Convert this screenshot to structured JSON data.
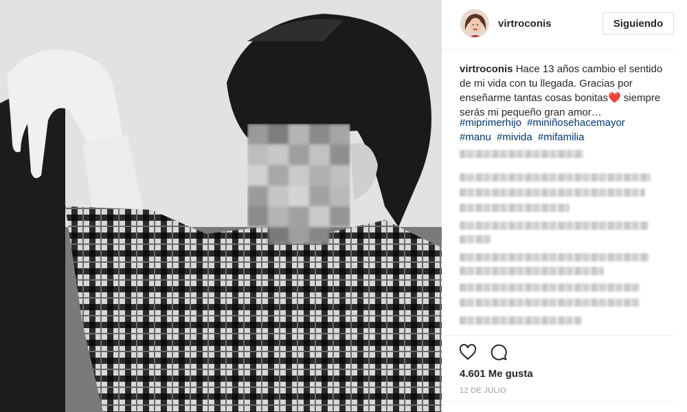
{
  "post": {
    "username": "virtroconis",
    "follow_label": "Siguiendo",
    "caption_user": "virtroconis",
    "caption_text": "Hace 13 años cambio el sentido de mi vida con tu llegada. Gracias por enseñarme tantas cosas bonitas❤️ siempre serás mi pequeño gran amor…",
    "hashtags": [
      "#miprimerhijo",
      "#miniñosehacemayor",
      "#manu",
      "#mivida",
      "#mifamilia"
    ],
    "likes": "4.601 Me gusta",
    "date": "12 DE JULIO",
    "icons": [
      "heart-icon",
      "comment-icon"
    ]
  },
  "colors": {
    "hashtag": "#003569",
    "text": "#262626",
    "muted": "#999999",
    "border": "#dbdbdb"
  }
}
